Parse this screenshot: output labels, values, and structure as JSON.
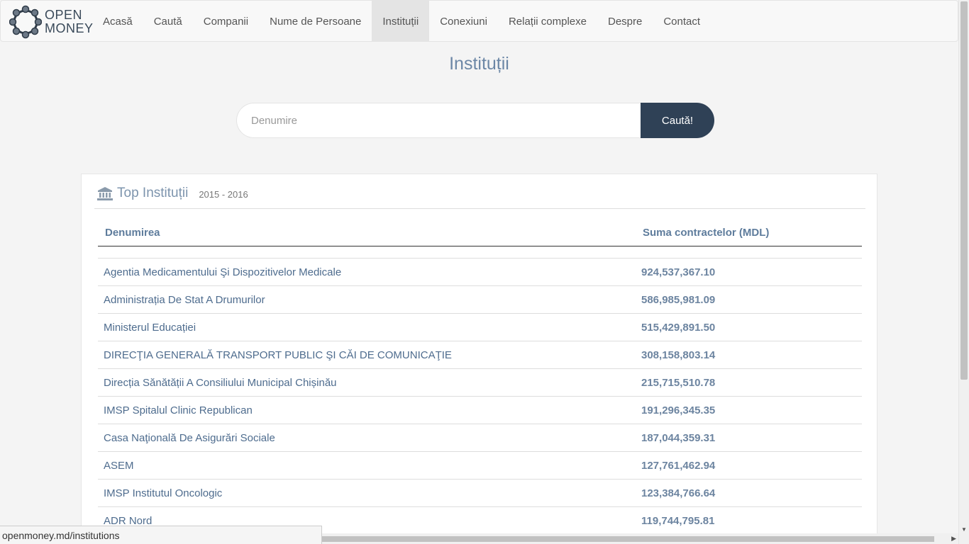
{
  "brand": {
    "line1": "OPEN",
    "line2": "MONEY"
  },
  "nav": {
    "items": [
      {
        "label": "Acasă"
      },
      {
        "label": "Caută"
      },
      {
        "label": "Companii"
      },
      {
        "label": "Nume de Persoane"
      },
      {
        "label": "Instituții"
      },
      {
        "label": "Conexiuni"
      },
      {
        "label": "Relații complexe"
      },
      {
        "label": "Despre"
      },
      {
        "label": "Contact"
      }
    ],
    "active": "Instituții"
  },
  "page": {
    "title": "Instituții"
  },
  "search": {
    "placeholder": "Denumire",
    "value": "",
    "button_label": "Caută!"
  },
  "panel": {
    "title": "Top Instituții",
    "period": "2015 - 2016",
    "columns": {
      "name": "Denumirea",
      "sum": "Suma contractelor (MDL)"
    },
    "rows": [
      {
        "name": "Agentia Medicamentului Şi Dispozitivelor Medicale",
        "sum": "924,537,367.10"
      },
      {
        "name": "Administrația De Stat A Drumurilor",
        "sum": "586,985,981.09"
      },
      {
        "name": "Ministerul Educației",
        "sum": "515,429,891.50"
      },
      {
        "name": "DIRECŢIA GENERALĂ TRANSPORT PUBLIC ŞI CĂI DE COMUNICAŢIE",
        "sum": "308,158,803.14"
      },
      {
        "name": "Direcția Sănătății A Consiliului Municipal Chișinău",
        "sum": "215,715,510.78"
      },
      {
        "name": "IMSP Spitalul Clinic Republican",
        "sum": "191,296,345.35"
      },
      {
        "name": "Casa Naţională De Asigurări Sociale",
        "sum": "187,044,359.31"
      },
      {
        "name": "ASEM",
        "sum": "127,761,462.94"
      },
      {
        "name": "IMSP Institutul Oncologic",
        "sum": "123,384,766.64"
      },
      {
        "name": "ADR Nord",
        "sum": "119,744,795.81"
      }
    ]
  },
  "statusbar": {
    "url": "openmoney.md/institutions"
  },
  "icons": {
    "logo": "openmoney-logo-icon",
    "panel": "bank-icon"
  },
  "colors": {
    "button": "#2f4156",
    "link": "#4e6c8e",
    "nav_active_bg": "#e4e4e4"
  }
}
